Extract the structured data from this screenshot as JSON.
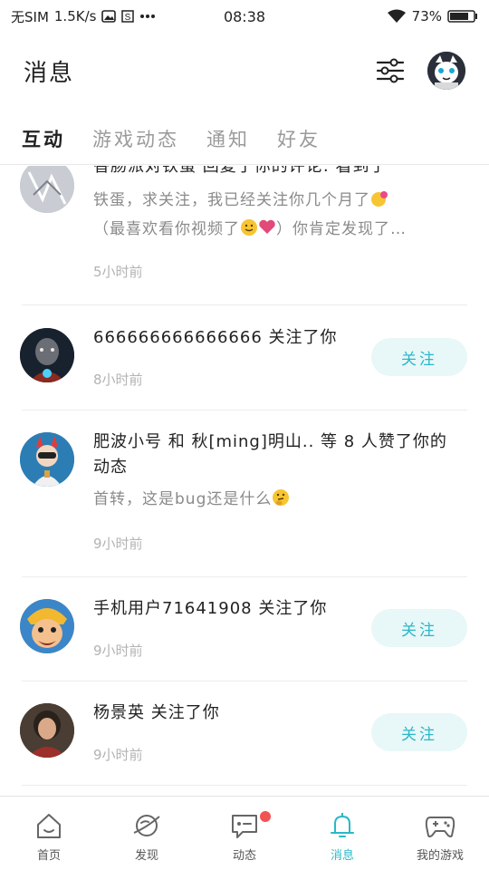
{
  "status_bar": {
    "carrier": "无SIM",
    "speed": "1.5K/s",
    "time": "08:38",
    "battery": "73%",
    "icons": [
      "image-icon",
      "s-icon",
      "more-dots-icon",
      "wifi-icon",
      "battery-icon"
    ]
  },
  "header": {
    "title": "消息",
    "filter_icon": "sliders-icon"
  },
  "tabs": [
    {
      "label": "互动",
      "active": true
    },
    {
      "label": "游戏动态",
      "active": false
    },
    {
      "label": "通知",
      "active": false
    },
    {
      "label": "好友",
      "active": false
    }
  ],
  "messages": [
    {
      "title": "香肠派对铁蛋 回复了你的评论: 看到了",
      "body_line1": "铁蛋，求关注，我已经关注你几个月了",
      "body_line2": "（最喜欢看你视频了",
      "body_line2_end": "）你肯定发现了…",
      "time": "5小时前"
    },
    {
      "title": "666666666666666 关注了你",
      "time": "8小时前",
      "button": "关注"
    },
    {
      "title_line1": "肥波小号 和 秋[ming]明山.. 等 8 人赞了你的",
      "title_line2": "动态",
      "body_line1": "首转，这是bug还是什么",
      "time": "9小时前"
    },
    {
      "title": "手机用户71641908 关注了你",
      "time": "9小时前",
      "button": "关注"
    },
    {
      "title": "杨景英 关注了你",
      "time": "9小时前",
      "button": "关注"
    }
  ],
  "bottom_nav": [
    {
      "label": "首页",
      "icon": "home-icon",
      "active": false
    },
    {
      "label": "发现",
      "icon": "planet-icon",
      "active": false
    },
    {
      "label": "动态",
      "icon": "chat-icon",
      "active": false,
      "badge_dot": true
    },
    {
      "label": "消息",
      "icon": "bell-icon",
      "active": true
    },
    {
      "label": "我的游戏",
      "icon": "gamepad-icon",
      "active": false
    }
  ],
  "colors": {
    "accent": "#2bb8c8",
    "follow_bg": "#e8f7f8",
    "badge_red": "#f25252",
    "muted_text": "#8a8a8a",
    "time_text": "#b3b3b3"
  }
}
